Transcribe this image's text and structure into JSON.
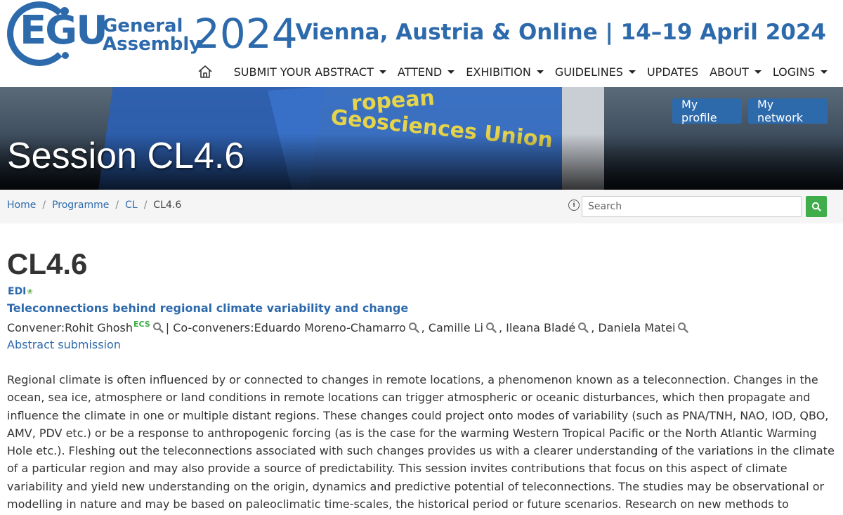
{
  "header": {
    "logo": {
      "egu": "EGU",
      "general": "General",
      "assembly": "Assembly",
      "year": "2024"
    },
    "tagline": "Vienna, Austria & Online | 14–19 April 2024",
    "nav": [
      {
        "label": "SUBMIT YOUR ABSTRACT",
        "dropdown": true
      },
      {
        "label": "ATTEND",
        "dropdown": true
      },
      {
        "label": "EXHIBITION",
        "dropdown": true
      },
      {
        "label": "GUIDELINES",
        "dropdown": true
      },
      {
        "label": "UPDATES",
        "dropdown": false
      },
      {
        "label": "ABOUT",
        "dropdown": true
      },
      {
        "label": "LOGINS",
        "dropdown": true
      }
    ]
  },
  "banner": {
    "title": "Session CL4.6",
    "flag_text_1": "ropean",
    "flag_text_2": "Geosciences Union",
    "my_profile": "My profile",
    "my_network": "My network"
  },
  "breadcrumb": {
    "items": [
      "Home",
      "Programme",
      "CL"
    ],
    "separator": "/",
    "current": "CL4.6"
  },
  "search": {
    "placeholder": "Search"
  },
  "session": {
    "code": "CL4.6",
    "tag": "EDI",
    "title": "Teleconnections behind regional climate variability and change",
    "convener_label": "Convener: ",
    "convener": "Rohit Ghosh",
    "convener_badge": "ECS",
    "co_label": " | Co-conveners: ",
    "co_conveners": [
      "Eduardo Moreno-Chamarro",
      "Camille Li",
      "Ileana Bladé",
      "Daniela Matei"
    ],
    "abstract_link": "Abstract submission",
    "description": "Regional climate is often influenced by or connected to changes in remote locations, a phenomenon known as a teleconnection. Changes in the ocean, sea ice, atmosphere or land conditions in remote locations can trigger atmospheric or oceanic disturbances, which then propagate and influence the climate in one or multiple distant regions. These changes could project onto modes of variability (such as PNA/TNH, NAO, IOD, QBO, AMV, PDV etc.) or be a response to anthropogenic forcing (as is the case for the warming Western Tropical Pacific or the North Atlantic Warming Hole etc.). Fleshing out the teleconnections associated with such changes provides us with a clearer understanding of the variations in the climate of a particular region and may also provide a source of predictability. This session invites contributions that focus on this aspect of climate variability and yield new understanding on the origin, dynamics and predictive potential of teleconnections. The studies may be observational or modelling in nature and may be based on paleoclimatic time-scales, the historical period or future scenarios. Research on new methods to diagnose and understand teleconnections is also welcome."
  },
  "colors": {
    "brand_blue": "#2d6aac",
    "search_green": "#3fae4a",
    "ecs_green": "#3fae4a"
  },
  "icons": [
    "home-icon",
    "info-icon",
    "search-icon",
    "magnifier-icon",
    "dropdown-caret-icon"
  ]
}
